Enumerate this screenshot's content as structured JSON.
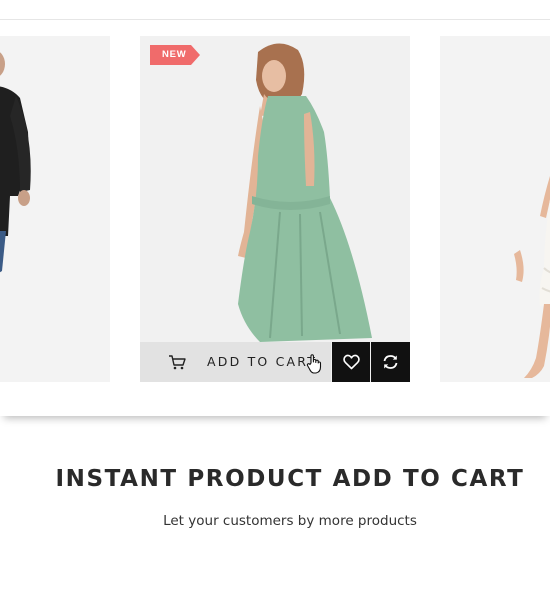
{
  "carousel": {
    "center_card": {
      "badge": "NEW",
      "add_to_cart_label": "ADD TO CART"
    }
  },
  "feature": {
    "title": "INSTANT PRODUCT ADD TO CART",
    "subtitle": "Let your customers by more products"
  },
  "icons": {
    "cart": "shopping-cart-icon",
    "cursor": "hand-pointer-icon",
    "wishlist": "heart-icon",
    "compare": "refresh-icon"
  },
  "colors": {
    "badge": "#f06b6b",
    "action_dark": "#111111",
    "cart_bar": "#e2e2e2",
    "dress": "#8fbfa1"
  }
}
